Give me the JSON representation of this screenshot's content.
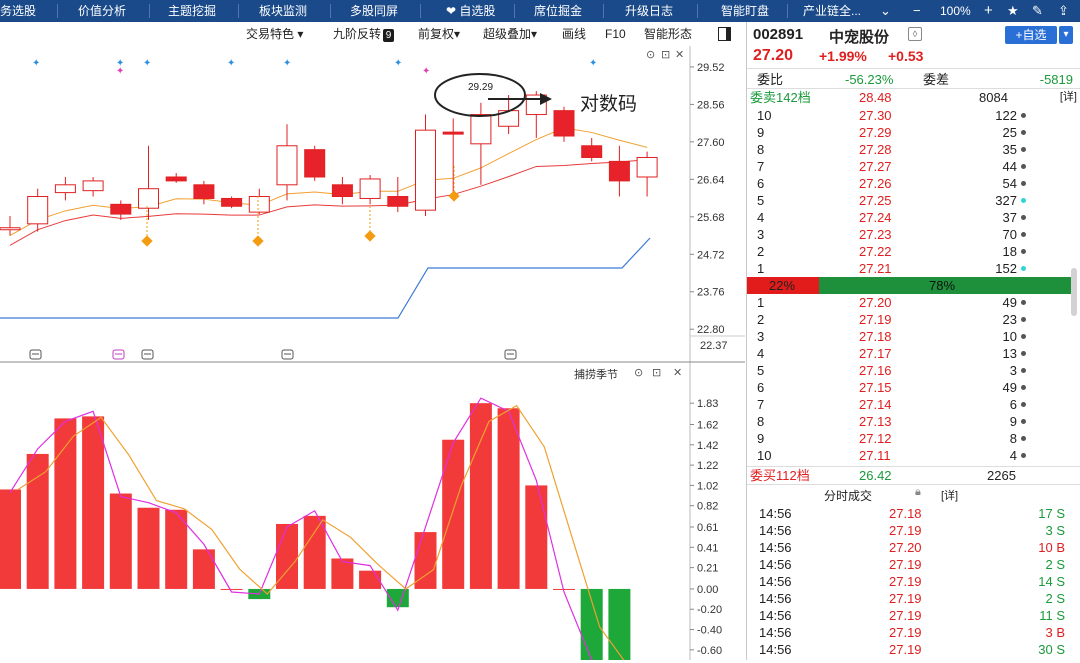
{
  "nav": {
    "items": [
      "务选股",
      "价值分析",
      "主题挖掘",
      "板块监测",
      "多股同屏",
      "自选股",
      "席位掘金",
      "升级日志",
      "智能盯盘",
      "产业链全..."
    ],
    "zoom": "100%"
  },
  "toolbar": {
    "items": [
      "交易特色",
      "九阶反转",
      "前复权",
      "超级叠加",
      "画线",
      "F10",
      "智能形态"
    ],
    "nine_badge": "9"
  },
  "chart_data": [
    {
      "type": "candlestick",
      "ylim": [
        22.37,
        29.8
      ],
      "yticks": [
        29.52,
        28.56,
        27.6,
        26.64,
        25.68,
        24.72,
        23.76,
        22.8
      ],
      "bottom_label": "22.37",
      "annotation": {
        "text": "29.29",
        "arrow_label": "对数码"
      },
      "candles": [
        {
          "o": 25.4,
          "c": 25.4,
          "h": 25.7,
          "l": 25.2,
          "color": "red"
        },
        {
          "o": 25.5,
          "c": 26.2,
          "h": 26.4,
          "l": 25.3,
          "color": "red"
        },
        {
          "o": 26.3,
          "c": 26.5,
          "h": 26.7,
          "l": 26.1,
          "color": "red"
        },
        {
          "o": 26.35,
          "c": 26.6,
          "h": 26.7,
          "l": 26.2,
          "color": "red"
        },
        {
          "o": 26.0,
          "c": 25.75,
          "h": 26.1,
          "l": 25.6,
          "color": "filled"
        },
        {
          "o": 25.9,
          "c": 26.4,
          "h": 27.5,
          "l": 25.6,
          "color": "red"
        },
        {
          "o": 26.7,
          "c": 26.6,
          "h": 26.8,
          "l": 26.55,
          "color": "filled"
        },
        {
          "o": 26.5,
          "c": 26.15,
          "h": 26.6,
          "l": 26.0,
          "color": "filled"
        },
        {
          "o": 26.15,
          "c": 25.95,
          "h": 26.2,
          "l": 25.9,
          "color": "filled"
        },
        {
          "o": 25.8,
          "c": 26.2,
          "h": 26.4,
          "l": 25.75,
          "color": "red"
        },
        {
          "o": 26.5,
          "c": 27.5,
          "h": 28.05,
          "l": 26.1,
          "color": "red"
        },
        {
          "o": 27.4,
          "c": 26.7,
          "h": 27.5,
          "l": 26.6,
          "color": "filled"
        },
        {
          "o": 26.5,
          "c": 26.2,
          "h": 26.7,
          "l": 26.0,
          "color": "filled"
        },
        {
          "o": 26.15,
          "c": 26.65,
          "h": 26.75,
          "l": 26.0,
          "color": "red"
        },
        {
          "o": 26.2,
          "c": 25.95,
          "h": 26.7,
          "l": 25.8,
          "color": "filled"
        },
        {
          "o": 25.85,
          "c": 27.9,
          "h": 28.3,
          "l": 25.7,
          "color": "red"
        },
        {
          "o": 27.85,
          "c": 27.8,
          "h": 28.2,
          "l": 26.2,
          "color": "filled"
        },
        {
          "o": 27.55,
          "c": 28.3,
          "h": 28.6,
          "l": 26.5,
          "color": "red"
        },
        {
          "o": 28.0,
          "c": 28.4,
          "h": 28.8,
          "l": 27.8,
          "color": "red"
        },
        {
          "o": 28.3,
          "c": 28.8,
          "h": 28.9,
          "l": 27.7,
          "color": "red"
        },
        {
          "o": 28.4,
          "c": 27.75,
          "h": 28.5,
          "l": 27.6,
          "color": "filled"
        },
        {
          "o": 27.5,
          "c": 27.2,
          "h": 27.7,
          "l": 27.1,
          "color": "filled"
        },
        {
          "o": 27.1,
          "c": 26.6,
          "h": 27.5,
          "l": 26.2,
          "color": "filled"
        },
        {
          "o": 26.7,
          "c": 27.2,
          "h": 27.35,
          "l": 26.2,
          "color": "red"
        }
      ]
    },
    {
      "type": "bar",
      "title": "捕捞季节",
      "ylim": [
        -0.7,
        1.95
      ],
      "yticks": [
        1.83,
        1.62,
        1.42,
        1.22,
        1.02,
        0.82,
        0.61,
        0.41,
        0.21,
        0.0,
        -0.2,
        -0.4,
        -0.6
      ],
      "ytick_labels": [
        "1.83",
        "1.62",
        "1.42",
        "1.22",
        "1.02",
        "0.82",
        "0.61",
        "0.41",
        "0.21",
        "0.00",
        "-0.20",
        "-0.40",
        "-0.60"
      ],
      "values": [
        0.98,
        1.33,
        1.68,
        1.7,
        0.94,
        0.8,
        0.78,
        0.39,
        0.0,
        -0.1,
        0.64,
        0.72,
        0.3,
        0.18,
        -0.18,
        0.56,
        1.47,
        1.83,
        1.78,
        1.02,
        0.0,
        -0.75,
        -0.75
      ]
    }
  ],
  "quote": {
    "code": "002891",
    "name": "中宠股份",
    "add_button": "+自选",
    "price": "27.20",
    "change_pct": "+1.99%",
    "change": "+0.53",
    "weibi_label": "委比",
    "weibi": "-56.23%",
    "weicha_label": "委差",
    "weicha": "-5819",
    "sell_total_label": "委卖142档",
    "sell_total_price": "28.48",
    "sell_total_vol": "8084",
    "detail": "[详]",
    "asks": [
      {
        "lvl": "10",
        "price": "27.30",
        "vol": "122",
        "dot": "gray"
      },
      {
        "lvl": "9",
        "price": "27.29",
        "vol": "25",
        "dot": "gray"
      },
      {
        "lvl": "8",
        "price": "27.28",
        "vol": "35",
        "dot": "gray"
      },
      {
        "lvl": "7",
        "price": "27.27",
        "vol": "44",
        "dot": "gray"
      },
      {
        "lvl": "6",
        "price": "27.26",
        "vol": "54",
        "dot": "gray"
      },
      {
        "lvl": "5",
        "price": "27.25",
        "vol": "327",
        "dot": "cyan"
      },
      {
        "lvl": "4",
        "price": "27.24",
        "vol": "37",
        "dot": "gray"
      },
      {
        "lvl": "3",
        "price": "27.23",
        "vol": "70",
        "dot": "gray"
      },
      {
        "lvl": "2",
        "price": "27.22",
        "vol": "18",
        "dot": "gray"
      },
      {
        "lvl": "1",
        "price": "27.21",
        "vol": "152",
        "dot": "cyan"
      }
    ],
    "ratio_red": "22%",
    "ratio_green": "78%",
    "ratio_value": 0.22,
    "bids": [
      {
        "lvl": "1",
        "price": "27.20",
        "vol": "49"
      },
      {
        "lvl": "2",
        "price": "27.19",
        "vol": "23"
      },
      {
        "lvl": "3",
        "price": "27.18",
        "vol": "10"
      },
      {
        "lvl": "4",
        "price": "27.17",
        "vol": "13"
      },
      {
        "lvl": "5",
        "price": "27.16",
        "vol": "3"
      },
      {
        "lvl": "6",
        "price": "27.15",
        "vol": "49"
      },
      {
        "lvl": "7",
        "price": "27.14",
        "vol": "6"
      },
      {
        "lvl": "8",
        "price": "27.13",
        "vol": "9"
      },
      {
        "lvl": "9",
        "price": "27.12",
        "vol": "8"
      },
      {
        "lvl": "10",
        "price": "27.11",
        "vol": "4"
      }
    ],
    "buy_total_label": "委买112档",
    "buy_total_price": "26.42",
    "buy_total_vol": "2265",
    "ticks_title": "分时成交",
    "ticks": [
      {
        "time": "14:56",
        "price": "27.18",
        "vol": "17 S"
      },
      {
        "time": "14:56",
        "price": "27.19",
        "vol": "3 S"
      },
      {
        "time": "14:56",
        "price": "27.20",
        "vol": "10 B"
      },
      {
        "time": "14:56",
        "price": "27.19",
        "vol": "2 S"
      },
      {
        "time": "14:56",
        "price": "27.19",
        "vol": "14 S"
      },
      {
        "time": "14:56",
        "price": "27.19",
        "vol": "2 S"
      },
      {
        "time": "14:56",
        "price": "27.19",
        "vol": "11 S"
      },
      {
        "time": "14:56",
        "price": "27.19",
        "vol": "3 B"
      },
      {
        "time": "14:56",
        "price": "27.19",
        "vol": "30 S"
      }
    ]
  }
}
